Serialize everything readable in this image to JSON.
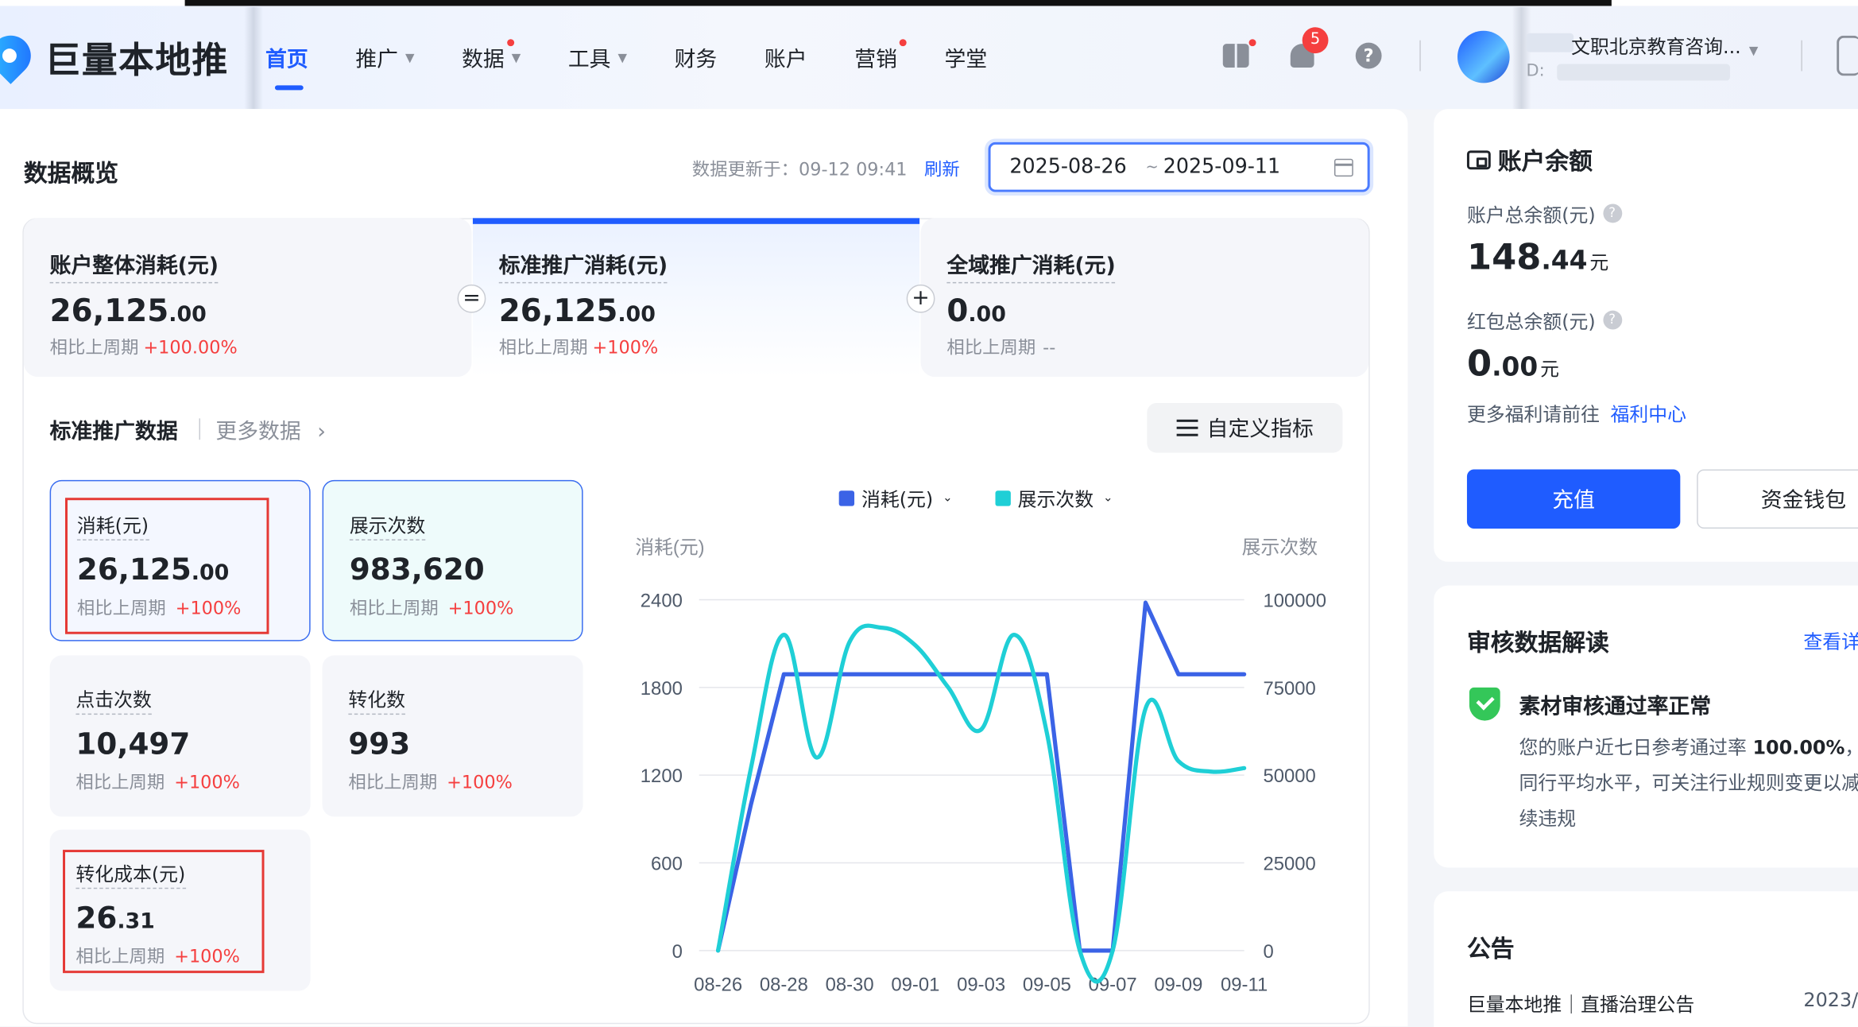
{
  "header": {
    "brand": "巨量本地推",
    "nav": [
      {
        "label": "首页",
        "active": true,
        "caret": false,
        "dot": false
      },
      {
        "label": "推广",
        "active": false,
        "caret": true,
        "dot": false
      },
      {
        "label": "数据",
        "active": false,
        "caret": true,
        "dot": true
      },
      {
        "label": "工具",
        "active": false,
        "caret": true,
        "dot": false
      },
      {
        "label": "财务",
        "active": false,
        "caret": false,
        "dot": false
      },
      {
        "label": "账户",
        "active": false,
        "caret": false,
        "dot": false
      },
      {
        "label": "营销",
        "active": false,
        "caret": false,
        "dot": true
      },
      {
        "label": "学堂",
        "active": false,
        "caret": false,
        "dot": false
      }
    ],
    "notification_count": "5",
    "help_glyph": "?",
    "account_name": "文职北京教育咨询...",
    "account_id_prefix": "D:"
  },
  "overview": {
    "title": "数据概览",
    "updated": "数据更新于：09-12 09:41",
    "refresh": "刷新",
    "date_start": "2025-08-26",
    "date_sep": "~",
    "date_end": "2025-09-11"
  },
  "summary": [
    {
      "label": "账户整体消耗(元)",
      "int": "26,125",
      "dec": ".00",
      "cmp_label": "相比上周期",
      "cmp_value": "+100.00%"
    },
    {
      "label": "标准推广消耗(元)",
      "int": "26,125",
      "dec": ".00",
      "cmp_label": "相比上周期",
      "cmp_value": "+100%"
    },
    {
      "label": "全域推广消耗(元)",
      "int": "0",
      "dec": ".00",
      "cmp_label": "相比上周期",
      "cmp_value": "--"
    }
  ],
  "operators": {
    "eq": "=",
    "plus": "+"
  },
  "section": {
    "title": "标准推广数据",
    "more": "更多数据",
    "more_arrow": "›",
    "custom": "自定义指标"
  },
  "metrics": [
    {
      "label": "消耗(元)",
      "int": "26,125",
      "dec": ".00",
      "cmp_label": "相比上周期",
      "cmp_value": "+100%"
    },
    {
      "label": "展示次数",
      "int": "983,620",
      "dec": "",
      "cmp_label": "相比上周期",
      "cmp_value": "+100%"
    },
    {
      "label": "点击次数",
      "int": "10,497",
      "dec": "",
      "cmp_label": "相比上周期",
      "cmp_value": "+100%"
    },
    {
      "label": "转化数",
      "int": "993",
      "dec": "",
      "cmp_label": "相比上周期",
      "cmp_value": "+100%"
    },
    {
      "label": "转化成本(元)",
      "int": "26",
      "dec": ".31",
      "cmp_label": "相比上周期",
      "cmp_value": "+100%"
    }
  ],
  "legend": [
    {
      "label": "消耗(元)",
      "color": "#3b63e6"
    },
    {
      "label": "展示次数",
      "color": "#1fcfd6"
    }
  ],
  "chart_data": {
    "type": "line",
    "x": [
      "08-26",
      "08-27",
      "08-28",
      "08-29",
      "08-30",
      "08-31",
      "09-01",
      "09-02",
      "09-03",
      "09-04",
      "09-05",
      "09-06",
      "09-07",
      "09-08",
      "09-09",
      "09-10",
      "09-11"
    ],
    "x_tick_labels": [
      "08-26",
      "08-28",
      "08-30",
      "09-01",
      "09-03",
      "09-05",
      "09-07",
      "09-09",
      "09-11"
    ],
    "ylabel_left": "消耗(元)",
    "ylabel_right": "展示次数",
    "y_left_ticks": [
      "0",
      "600",
      "1200",
      "1800",
      "2400"
    ],
    "y_right_ticks": [
      "0",
      "25000",
      "50000",
      "75000",
      "100000"
    ],
    "ylim_left": [
      0,
      2400
    ],
    "ylim_right": [
      0,
      100000
    ],
    "grid": true,
    "series": [
      {
        "name": "消耗(元)",
        "axis": "left",
        "color": "#3b63e6",
        "values": [
          0,
          1000,
          1890,
          1890,
          1890,
          1890,
          1890,
          1890,
          1890,
          1890,
          1890,
          0,
          0,
          2380,
          1890,
          1890,
          1890
        ]
      },
      {
        "name": "展示次数",
        "axis": "right",
        "color": "#1fcfd6",
        "values": [
          0,
          52000,
          90000,
          55000,
          88000,
          92000,
          87000,
          75000,
          63000,
          90000,
          62000,
          0,
          0,
          69000,
          54000,
          51000,
          52000
        ]
      }
    ]
  },
  "balance": {
    "title": "账户余额",
    "total_label": "账户总余额(元)",
    "total_int": "148",
    "total_dec": ".44",
    "unit": "元",
    "red_label": "红包总余额(元)",
    "red_int": "0",
    "red_dec": ".00",
    "welfare_prefix": "更多福利请前往",
    "welfare_link": "福利中心",
    "recharge": "充值",
    "wallet": "资金钱包"
  },
  "audit": {
    "title": "审核数据解读",
    "view": "查看详",
    "head": "素材审核通过率正常",
    "body_prefix": "您的账户近七日参考通过率",
    "body_rate": "100.00%",
    "body_rest": "，同行平均水平，可关注行业规则变更以减续违规"
  },
  "notice": {
    "title": "公告",
    "item": "巨量本地推｜直播治理公告",
    "date": "2023/"
  }
}
